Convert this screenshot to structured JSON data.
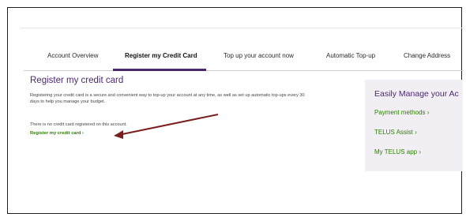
{
  "tabs": [
    {
      "label": "Account Overview",
      "active": false
    },
    {
      "label": "Register my Credit Card",
      "active": true
    },
    {
      "label": "Top up your account now",
      "active": false
    },
    {
      "label": "Automatic Top-up",
      "active": false
    },
    {
      "label": "Change Address",
      "active": false
    }
  ],
  "main": {
    "title": "Register my credit card",
    "description": "Registering your credit card is a secure and convenient way to top-up your account at any time, as well as set up automatic top-ups every 30 days to help you manage your budget.",
    "status": "There is no credit card registered on this account.",
    "register_link": "Register my credit card ›"
  },
  "panel": {
    "title": "Easily Manage your Ac",
    "links": [
      "Payment methods ›",
      "TELUS Assist ›",
      "My TELUS app ›"
    ]
  },
  "annotation": {
    "color": "#7a1f1f"
  },
  "colors": {
    "brand_purple": "#4b286d",
    "link_green": "#2b8000",
    "panel_bg": "#f2eff4"
  }
}
